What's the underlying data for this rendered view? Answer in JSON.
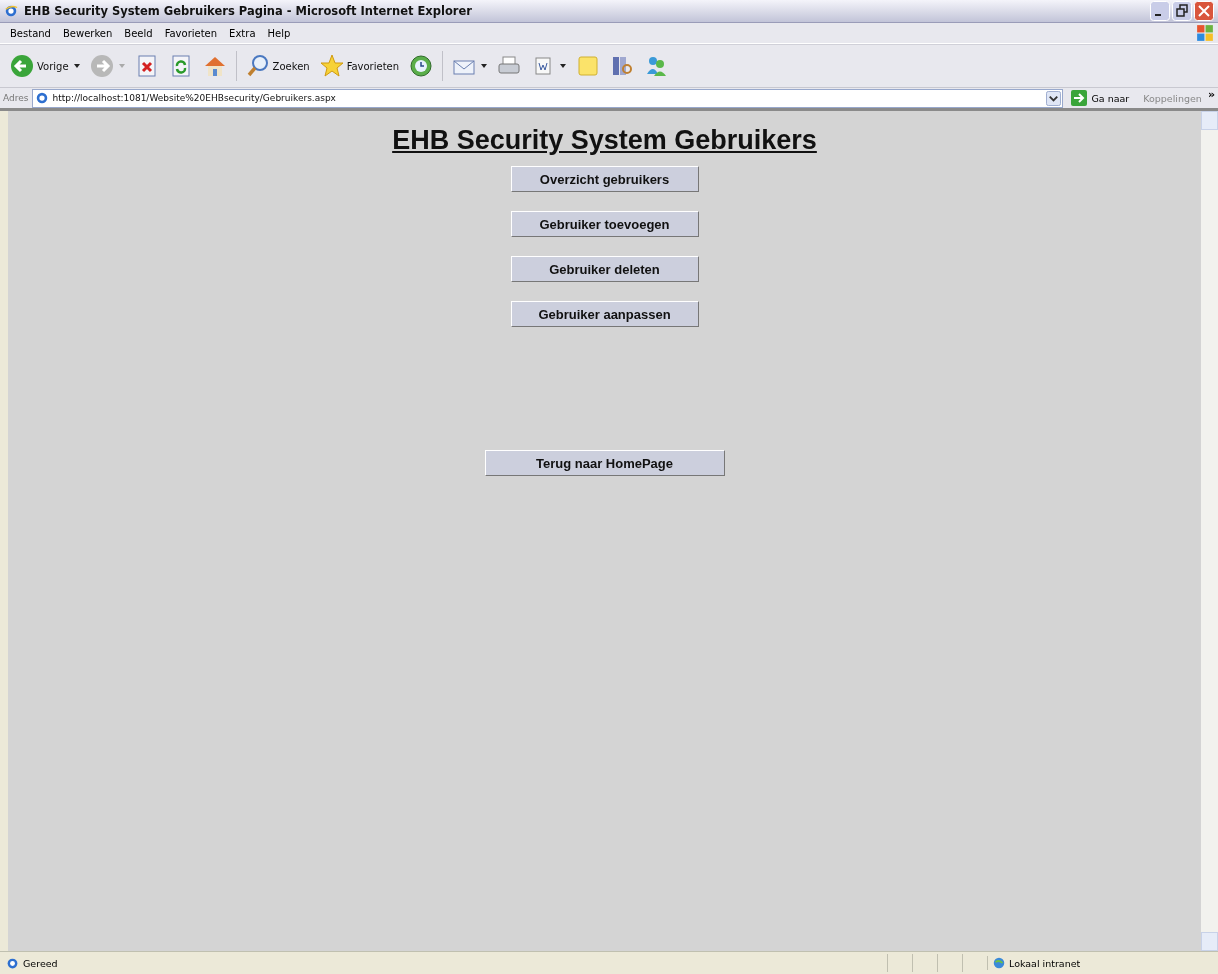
{
  "window": {
    "title": "EHB Security System Gebruikers Pagina - Microsoft Internet Explorer"
  },
  "menu_bar": [
    "Bestand",
    "Bewerken",
    "Beeld",
    "Favorieten",
    "Extra",
    "Help"
  ],
  "toolbar": [
    {
      "kind": "back",
      "label": "Vorige",
      "dropdown": true
    },
    {
      "kind": "forward",
      "dropdown": true
    },
    {
      "kind": "stop",
      "dropdown": false
    },
    {
      "kind": "refresh",
      "dropdown": false
    },
    {
      "kind": "home",
      "dropdown": false
    },
    {
      "kind": "search",
      "label": "Zoeken",
      "dropdown": false
    },
    {
      "kind": "favorites",
      "label": "Favorieten",
      "dropdown": false
    },
    {
      "kind": "history",
      "dropdown": false
    },
    {
      "kind": "mail",
      "dropdown": true
    },
    {
      "kind": "print",
      "dropdown": false
    },
    {
      "kind": "edit",
      "dropdown": true
    },
    {
      "kind": "notes",
      "dropdown": false
    },
    {
      "kind": "research",
      "dropdown": false
    },
    {
      "kind": "messenger",
      "dropdown": false
    }
  ],
  "address_bar": {
    "label": "Adres",
    "url": "http://localhost:1081/Website%20EHBsecurity/Gebruikers.aspx",
    "go_button": "Ga naar",
    "links": "Koppelingen",
    "more": "»"
  },
  "page": {
    "heading": "EHB Security System Gebruikers",
    "buttons": [
      "Overzicht gebruikers",
      "Gebruiker toevoegen",
      "Gebruiker deleten",
      "Gebruiker aanpassen"
    ],
    "home_button": "Terug naar HomePage"
  },
  "status_bar": {
    "text": "Gereed",
    "zone": "Lokaal intranet"
  }
}
